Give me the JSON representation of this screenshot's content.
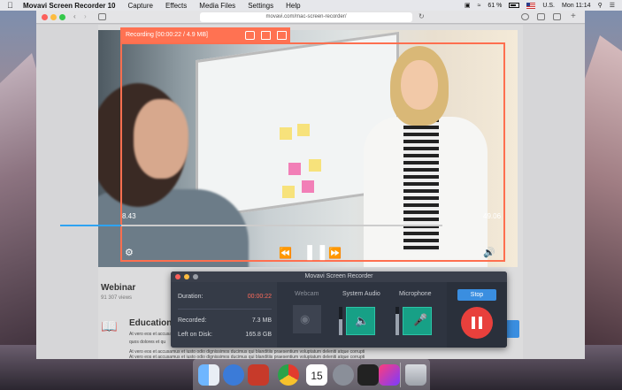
{
  "menubar": {
    "app_name": "Movavi Screen Recorder 10",
    "items": [
      "Capture",
      "Effects",
      "Media Files",
      "Settings",
      "Help"
    ],
    "battery": "61 %",
    "input_source": "U.S.",
    "clock": "Mon 11:14"
  },
  "browser": {
    "url": "movavi.com/mac-screen-recorder/"
  },
  "video": {
    "time_elapsed": "8.43",
    "time_total": "49.06",
    "progress": 0.16
  },
  "recording": {
    "status": "Recording [00:00:22 / 4.9 MB]"
  },
  "page": {
    "title": "Webinar",
    "views": "91 307 views",
    "section_title": "Education",
    "para1": "At vero eos et accusamus et iusto odio",
    "para1b": "quos dolores et qu",
    "para2": "At vero eos et accusamus et iusto odio dignissimos ducimus qui blanditiis praesentium voluptatum deleniti atque corrupti",
    "para3": "At vero eos et accusamus et iusto odio dignissimos ducimus qui blanditiis praesentium voluptatum deleniti atque corrupti"
  },
  "panel": {
    "title": "Movavi Screen Recorder",
    "duration_label": "Duration:",
    "duration_value": "00:00:22",
    "recorded_label": "Recorded:",
    "recorded_value": "7.3 MB",
    "disk_label": "Left on Disk:",
    "disk_value": "165.8 GB",
    "webcam_label": "Webcam",
    "system_audio_label": "System Audio",
    "microphone_label": "Microphone",
    "stop_label": "Stop",
    "system_audio_level": 0.55,
    "microphone_level": 0.75
  },
  "colors": {
    "rec_orange": "#ff7252",
    "panel_bg": "#2e3440",
    "teal": "#17a086",
    "stop_blue": "#3a8ee0",
    "pause_red": "#e8403c",
    "duration_red": "#ff6b5b"
  },
  "dock": [
    "finder-icon",
    "launchpad-icon",
    "safari-icon",
    "photo-booth-icon",
    "chrome-icon",
    "calendar-icon",
    "system-preferences-icon",
    "screen-recorder-icon",
    "trash-icon"
  ],
  "calendar_day": "15"
}
